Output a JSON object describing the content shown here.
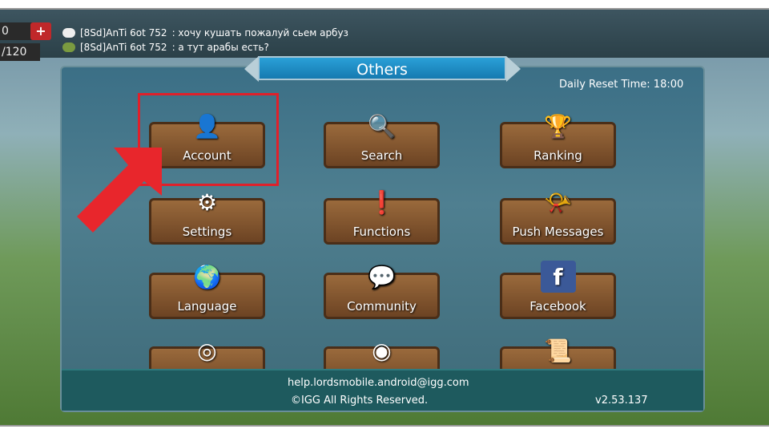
{
  "topbar": {
    "resource_value": "0",
    "resource_capacity": "/120",
    "add_label": "+"
  },
  "chat": [
    {
      "sender": "[8Sd]AnTi 6ot 752",
      "message": ": хочу кушать  пожалуй сьем арбуз",
      "icon": "chat-bubble-icon"
    },
    {
      "sender": "[8Sd]AnTi 6ot 752",
      "message": ": а тут арабы есть?",
      "icon": "guild-icon"
    }
  ],
  "panel": {
    "title": "Others",
    "daily_reset": "Daily Reset Time: 18:00"
  },
  "buttons": [
    {
      "label": "Account",
      "icon": "account-icon",
      "glyph": "👤"
    },
    {
      "label": "Search",
      "icon": "search-icon",
      "glyph": "🔍"
    },
    {
      "label": "Ranking",
      "icon": "ranking-icon",
      "glyph": "🏆"
    },
    {
      "label": "Settings",
      "icon": "gear-icon",
      "glyph": "⚙"
    },
    {
      "label": "Functions",
      "icon": "exclamation-icon",
      "glyph": "❗"
    },
    {
      "label": "Push Messages",
      "icon": "horn-icon",
      "glyph": "📯"
    },
    {
      "label": "Language",
      "icon": "globe-icon",
      "glyph": "🌍"
    },
    {
      "label": "Community",
      "icon": "chat-icon",
      "glyph": "💬"
    },
    {
      "label": "Facebook",
      "icon": "facebook-icon",
      "glyph": "f"
    },
    {
      "label": "",
      "icon": "instagram-icon",
      "glyph": "◎"
    },
    {
      "label": "",
      "icon": "discord-icon",
      "glyph": "◉"
    },
    {
      "label": "",
      "icon": "scroll-icon",
      "glyph": "📜"
    }
  ],
  "footer": {
    "email": "help.lordsmobile.android@igg.com",
    "copyright": "©IGG All Rights Reserved.",
    "version": "v2.53.137"
  },
  "colors": {
    "highlight": "#e0202a",
    "banner": "#1f8cc4"
  }
}
